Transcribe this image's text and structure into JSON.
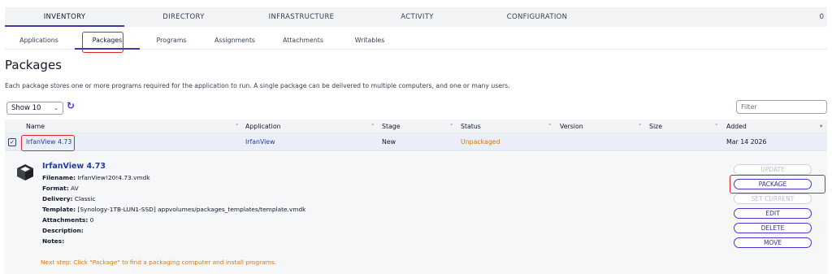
{
  "top_nav": {
    "tabs": [
      "INVENTORY",
      "DIRECTORY",
      "INFRASTRUCTURE",
      "ACTIVITY",
      "CONFIGURATION"
    ],
    "count": "0"
  },
  "sub_nav": {
    "tabs": [
      "Applications",
      "Packages",
      "Programs",
      "Assignments",
      "Attachments",
      "Writables"
    ]
  },
  "page": {
    "title": "Packages",
    "description": "Each package stores one or more programs required for the application to run. A single package can be delivered to multiple computers, and one or many users."
  },
  "controls": {
    "show_select": "Show 10",
    "filter_placeholder": "Filter"
  },
  "table": {
    "columns": [
      "Name",
      "Application",
      "Stage",
      "Status",
      "Version",
      "Size",
      "Added"
    ],
    "rows": [
      {
        "name": "IrfanView 4.73",
        "application": "IrfanView",
        "stage": "New",
        "status": "Unpackaged",
        "version": "",
        "size": "",
        "added": "Mar 14 2026"
      }
    ]
  },
  "detail": {
    "title": "IrfanView 4.73",
    "fields": [
      {
        "label": "Filename:",
        "value": "IrfanView!20!4.73.vmdk"
      },
      {
        "label": "Format:",
        "value": "AV"
      },
      {
        "label": "Delivery:",
        "value": "Classic"
      },
      {
        "label": "Template:",
        "value": "[Synology-1TB-LUN1-SSD] appvolumes/packages_templates/template.vmdk"
      },
      {
        "label": "Attachments:",
        "value": "0"
      },
      {
        "label": "Description:",
        "value": ""
      },
      {
        "label": "Notes:",
        "value": ""
      }
    ],
    "next_step": "Next step: Click \"Package\" to find a packaging computer and install programs.",
    "buttons": [
      {
        "label": "UPDATE",
        "enabled": false
      },
      {
        "label": "PACKAGE",
        "enabled": true
      },
      {
        "label": "SET CURRENT",
        "enabled": false
      },
      {
        "label": "EDIT",
        "enabled": true
      },
      {
        "label": "DELETE",
        "enabled": true
      },
      {
        "label": "MOVE",
        "enabled": true
      }
    ]
  },
  "colors": {
    "accent": "#3b3aa8",
    "link": "#1f3c9c",
    "warning": "#d97706",
    "highlight_box": "#e02424",
    "selected_row": "#e9eef9"
  }
}
